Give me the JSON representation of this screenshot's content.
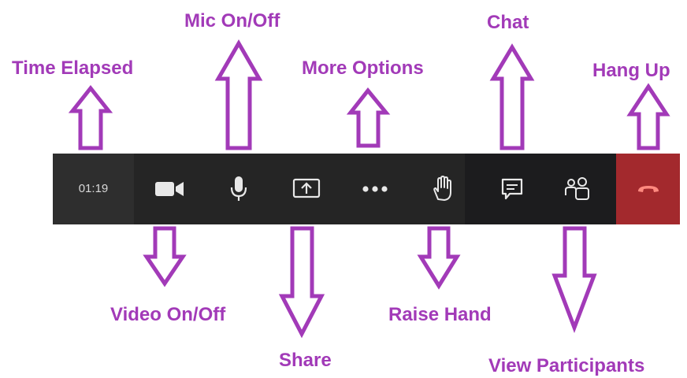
{
  "toolbar": {
    "time_elapsed": "01:19",
    "buttons": [
      {
        "id": "video",
        "icon": "video-camera-icon"
      },
      {
        "id": "mic",
        "icon": "microphone-icon"
      },
      {
        "id": "share",
        "icon": "share-screen-icon"
      },
      {
        "id": "more",
        "icon": "more-dots-icon"
      },
      {
        "id": "raise-hand",
        "icon": "hand-icon"
      },
      {
        "id": "chat",
        "icon": "chat-bubble-icon"
      },
      {
        "id": "participants",
        "icon": "people-icon"
      },
      {
        "id": "hang-up",
        "icon": "phone-hangup-icon"
      }
    ]
  },
  "annotations": {
    "time_elapsed": "Time Elapsed",
    "mic": "Mic On/Off",
    "more_options": "More Options",
    "chat": "Chat",
    "hang_up": "Hang Up",
    "video": "Video On/Off",
    "share": "Share",
    "raise_hand": "Raise Hand",
    "view_participants": "View Participants"
  },
  "colors": {
    "annotation": "#a23ab8",
    "toolbar_bg": "#252525",
    "hang_up_bg": "#a3292d",
    "icon": "#e8e8e8",
    "hang_icon": "#ff8a80"
  }
}
